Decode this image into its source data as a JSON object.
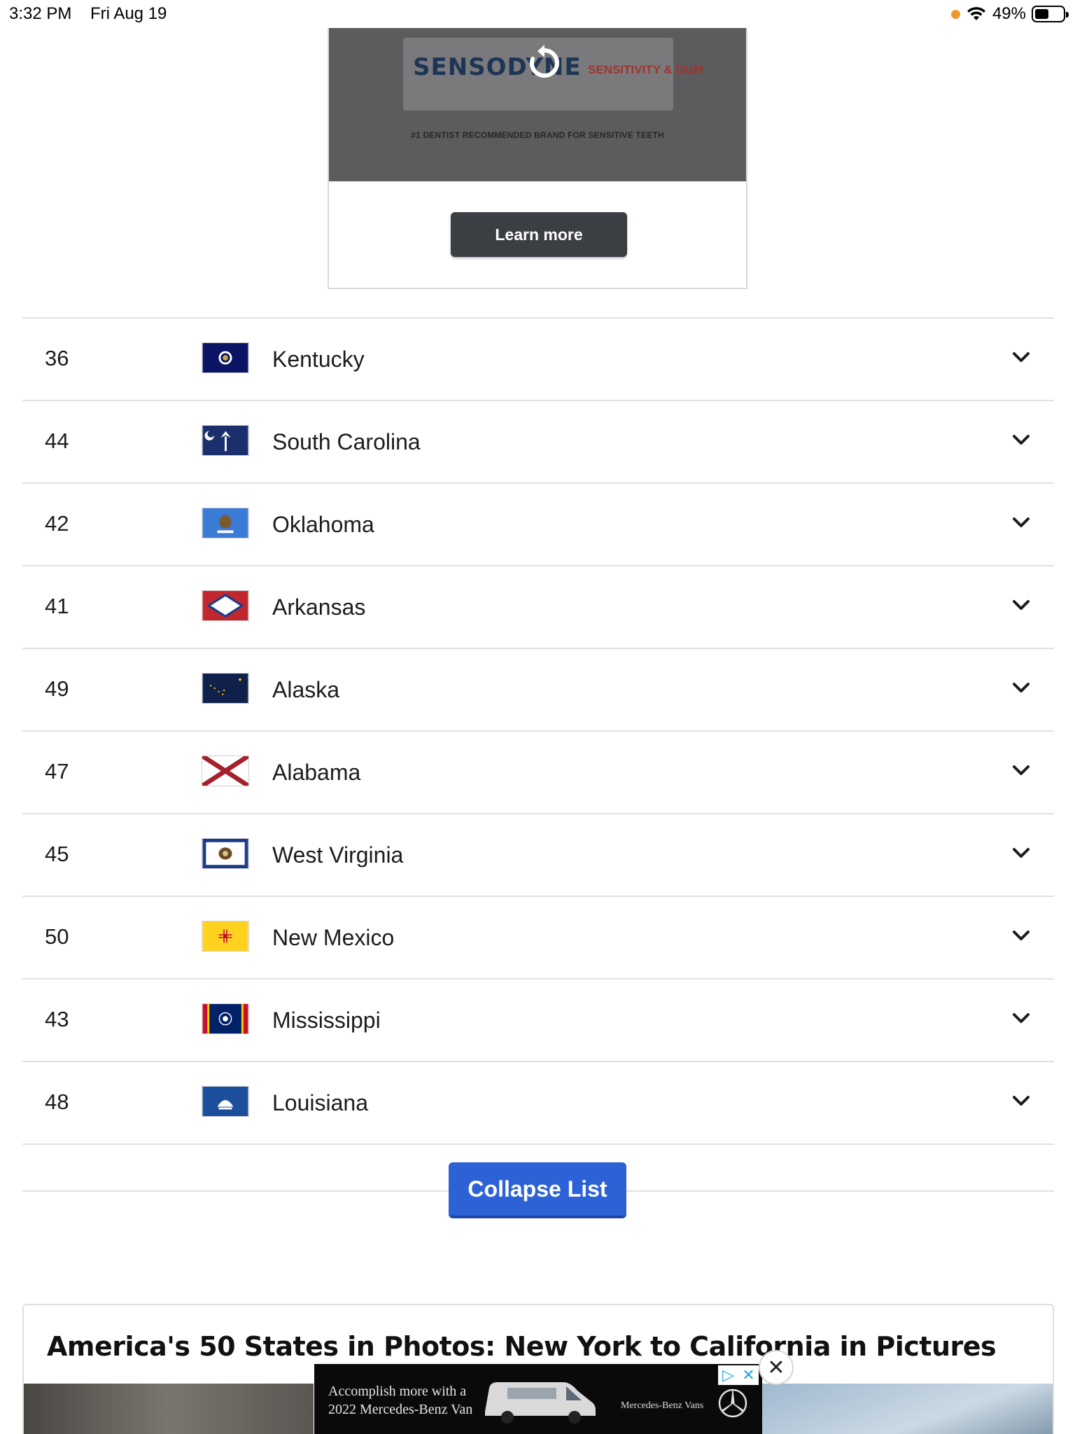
{
  "status_bar": {
    "time": "3:32 PM",
    "date": "Fri Aug 19",
    "battery_percent": "49%",
    "battery_level": 0.49,
    "recording_dot_color": "#f0962e"
  },
  "top_ad": {
    "brand": "SENSODYNE",
    "sub_brand": "SENSITIVITY & GUM",
    "tagline": "#1 DENTIST RECOMMENDED BRAND FOR SENSITIVE TEETH",
    "button_label": "Learn more"
  },
  "states": [
    {
      "rank": "36",
      "name": "Kentucky",
      "flag_icon": "kentucky-flag-icon"
    },
    {
      "rank": "44",
      "name": "South Carolina",
      "flag_icon": "south-carolina-flag-icon"
    },
    {
      "rank": "42",
      "name": "Oklahoma",
      "flag_icon": "oklahoma-flag-icon"
    },
    {
      "rank": "41",
      "name": "Arkansas",
      "flag_icon": "arkansas-flag-icon"
    },
    {
      "rank": "49",
      "name": "Alaska",
      "flag_icon": "alaska-flag-icon"
    },
    {
      "rank": "47",
      "name": "Alabama",
      "flag_icon": "alabama-flag-icon"
    },
    {
      "rank": "45",
      "name": "West Virginia",
      "flag_icon": "west-virginia-flag-icon"
    },
    {
      "rank": "50",
      "name": "New Mexico",
      "flag_icon": "new-mexico-flag-icon"
    },
    {
      "rank": "43",
      "name": "Mississippi",
      "flag_icon": "mississippi-flag-icon"
    },
    {
      "rank": "48",
      "name": "Louisiana",
      "flag_icon": "louisiana-flag-icon"
    }
  ],
  "collapse_button_label": "Collapse List",
  "article": {
    "title": "America's 50 States in Photos: New York to California in Pictures"
  },
  "bottom_ad": {
    "line1": "Accomplish more with a",
    "line2": "2022 Mercedes-Benz Van",
    "brand": "Mercedes-Benz Vans",
    "close_glyph": "✕"
  },
  "colors": {
    "primary_button": "#2d62d6",
    "ad_button": "#3b3f44",
    "divider": "#e1e1e1"
  }
}
